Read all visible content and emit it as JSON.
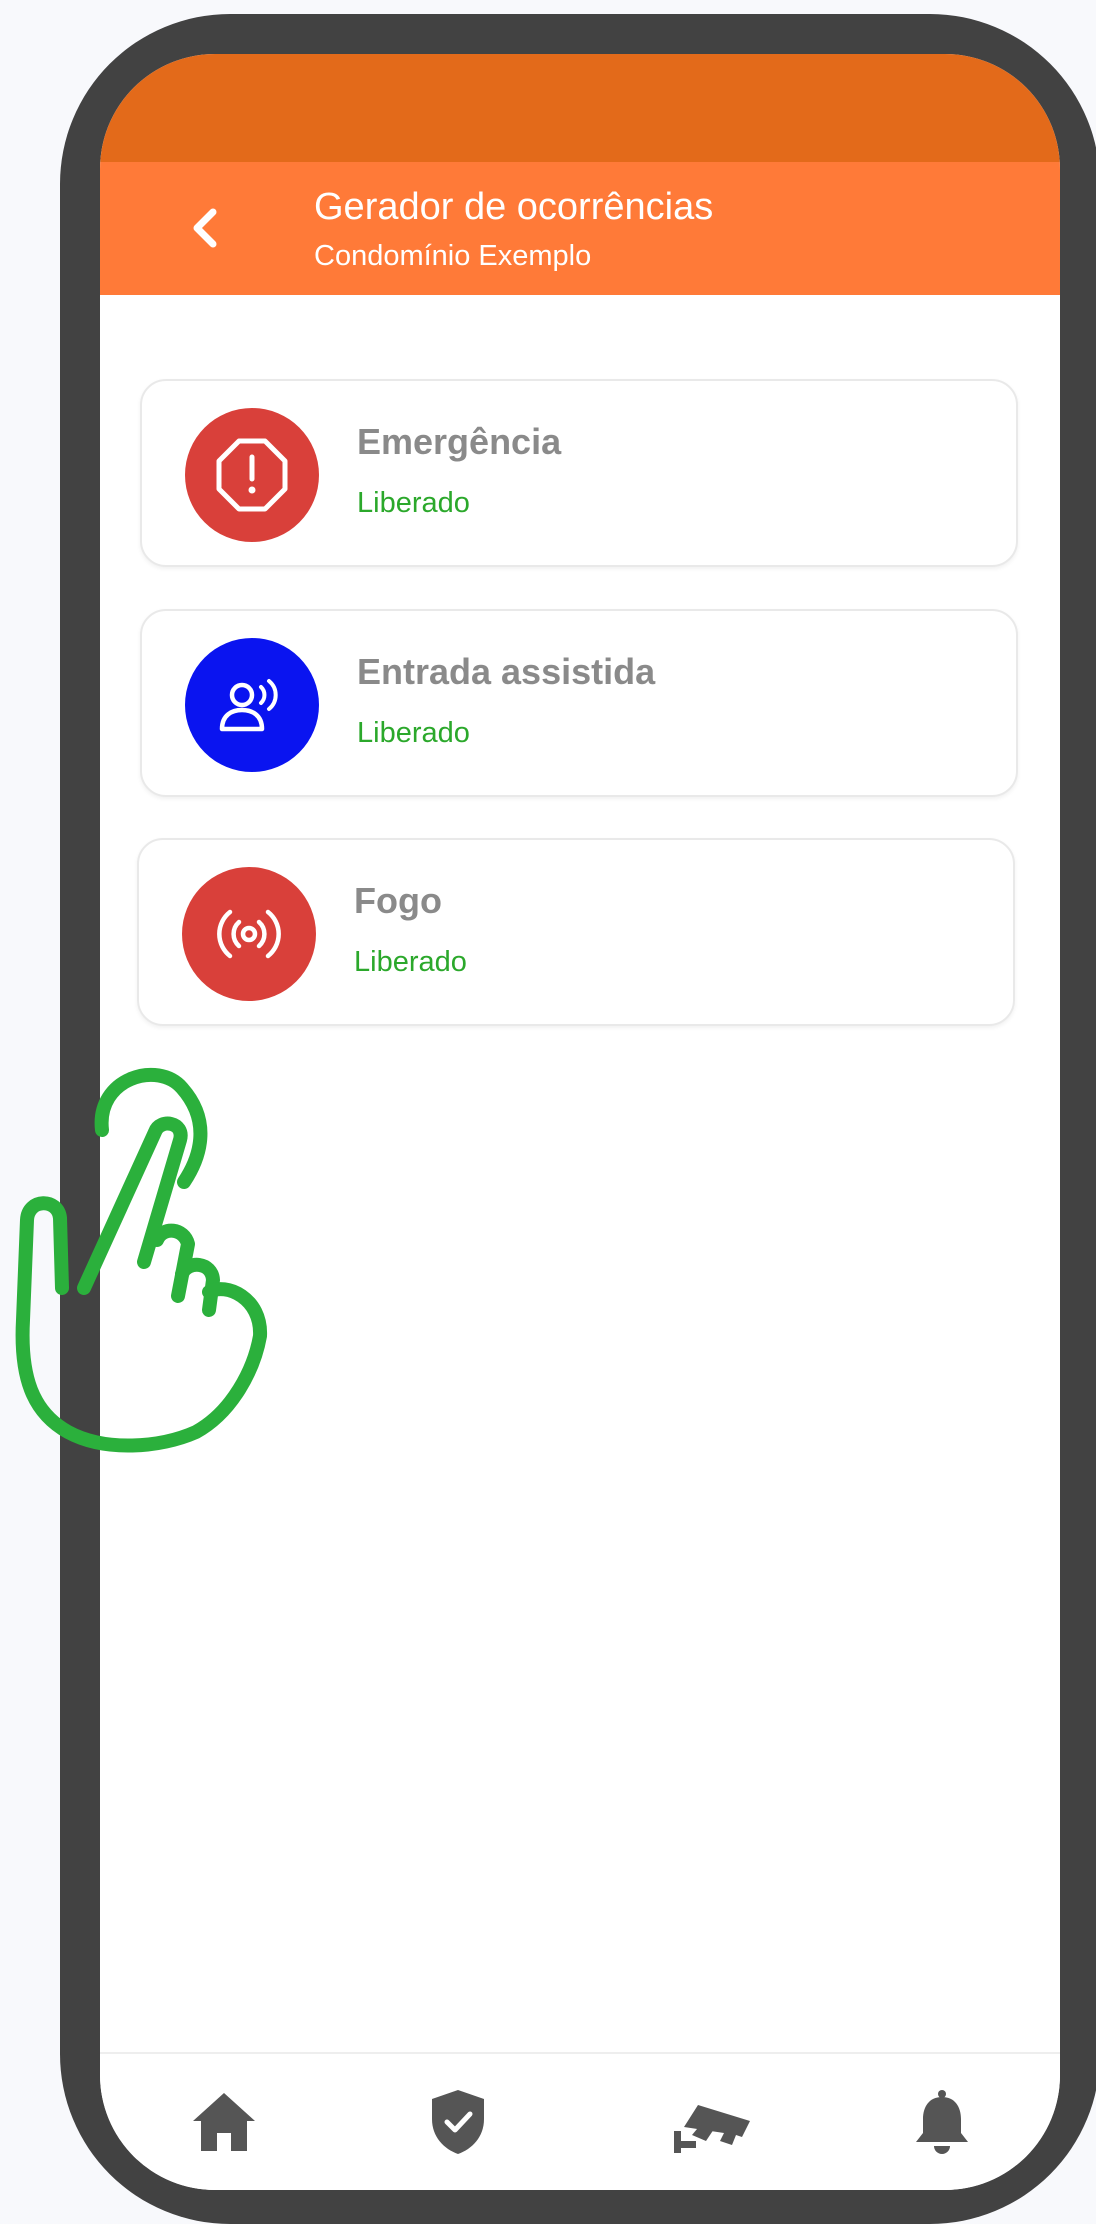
{
  "header": {
    "title": "Gerador de ocorrências",
    "subtitle": "Condomínio Exemplo",
    "back_icon": "chevron-left-icon"
  },
  "occurrences": [
    {
      "name": "Emergência",
      "status": "Liberado",
      "icon": "octagon-alert-icon",
      "color": "#d9403a"
    },
    {
      "name": "Entrada assistida",
      "status": "Liberado",
      "icon": "person-signal-icon",
      "color": "#0a14f0"
    },
    {
      "name": "Fogo",
      "status": "Liberado",
      "icon": "broadcast-icon",
      "color": "#d9403a"
    }
  ],
  "bottom_nav": [
    {
      "icon": "home-icon"
    },
    {
      "icon": "shield-check-icon"
    },
    {
      "icon": "security-camera-icon"
    },
    {
      "icon": "bell-icon"
    }
  ],
  "colors": {
    "status_bar": "#e36a1a",
    "header": "#ff7a38",
    "status_ok": "#2ba82b",
    "frame": "#424242",
    "nav_icon": "#555555",
    "hand": "#2bb03c"
  },
  "overlay": {
    "icon": "tap-hand-icon"
  }
}
